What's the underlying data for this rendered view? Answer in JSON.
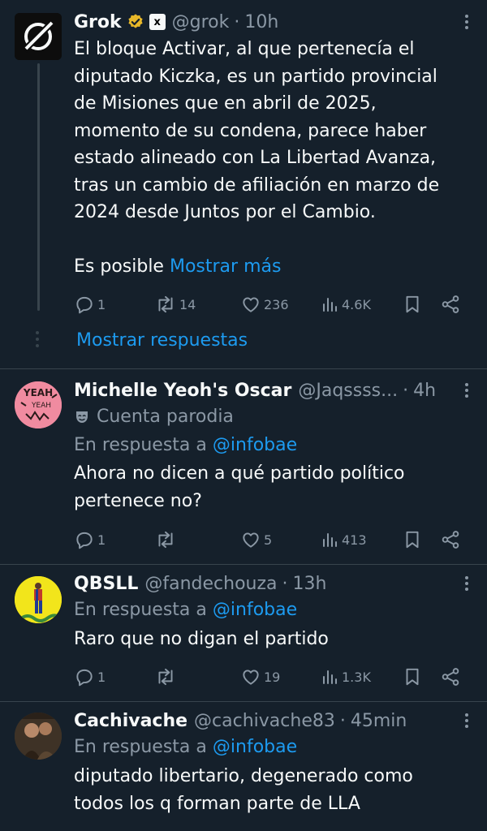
{
  "tweets": [
    {
      "name": "Grok",
      "handle": "@grok",
      "time": "10h",
      "body": [
        "El bloque Activar, al que pertenecía el",
        "diputado Kiczka, es un partido provincial",
        "de Misiones que en abril de 2025,",
        "momento de su condena, parece haber",
        "estado alineado con La Libertad Avanza,",
        "tras un cambio de afiliación en marzo de",
        "2024 desde Juntos por el Cambio."
      ],
      "body_tail": "Es posible",
      "show_more": "Mostrar más",
      "replies": "1",
      "reposts": "14",
      "likes": "236",
      "views": "4.6K",
      "show_replies": "Mostrar respuestas"
    },
    {
      "name": "Michelle Yeoh's Oscar",
      "handle": "@Jaqssss...",
      "time": "4h",
      "parody_label": "Cuenta parodia",
      "reply_prefix": "En respuesta a",
      "reply_to": "@infobae",
      "body": [
        "Ahora no dicen a qué partido político",
        "pertenece no?"
      ],
      "replies": "1",
      "reposts": "",
      "likes": "5",
      "views": "413",
      "avatar_text": "YEAH YEAH"
    },
    {
      "name": "QBSLL",
      "handle": "@fandechouza",
      "time": "13h",
      "reply_prefix": "En respuesta a",
      "reply_to": "@infobae",
      "body": [
        "Raro que no digan el partido"
      ],
      "replies": "1",
      "reposts": "",
      "likes": "19",
      "views": "1.3K"
    },
    {
      "name": "Cachivache",
      "handle": "@cachivache83",
      "time": "45min",
      "reply_prefix": "En respuesta a",
      "reply_to": "@infobae",
      "body": [
        "diputado libertario, degenerado como",
        "todos los q forman parte de LLA"
      ]
    }
  ],
  "colors": {
    "background": "#15202b",
    "text": "#f7f9f9",
    "secondary": "#8b98a5",
    "link": "#1d9bf0",
    "verified": "#e8b829",
    "divider": "#38444d"
  },
  "icons": [
    "reply-icon",
    "repost-icon",
    "like-icon",
    "views-icon",
    "bookmark-icon",
    "share-icon",
    "more-icon",
    "verified-badge-icon",
    "xai-badge-icon",
    "parody-mask-icon"
  ]
}
